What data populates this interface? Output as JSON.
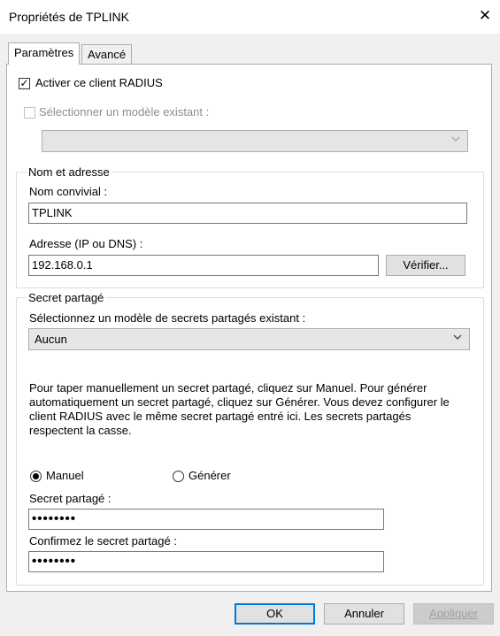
{
  "window": {
    "title": "Propriétés de TPLINK",
    "close_glyph": "✕"
  },
  "tabs": [
    {
      "label": "Paramètres",
      "active": true
    },
    {
      "label": "Avancé",
      "active": false
    }
  ],
  "radius_client": {
    "label": "Activer ce client RADIUS",
    "checked": true
  },
  "template": {
    "label": "Sélectionner un modèle existant :",
    "checked": false,
    "enabled": false,
    "value": ""
  },
  "name_address": {
    "legend": "Nom et adresse",
    "friendly_name_label": "Nom convivial :",
    "friendly_name_value": "TPLINK",
    "address_label": "Adresse (IP ou DNS) :",
    "address_value": "192.168.0.1",
    "verify_label": "Vérifier..."
  },
  "shared_secret": {
    "legend": "Secret partagé",
    "template_label": "Sélectionnez un modèle de secrets partagés existant :",
    "template_value": "Aucun",
    "description": "Pour taper manuellement un secret partagé, cliquez sur Manuel. Pour générer automatiquement un secret partagé, cliquez sur Générer. Vous devez configurer le client RADIUS avec le même secret partagé entré ici. Les secrets partagés respectent la casse.",
    "manual_label": "Manuel",
    "generate_label": "Générer",
    "selected_mode": "Manuel",
    "secret_label": "Secret partagé :",
    "secret_value": "••••••••",
    "confirm_label": "Confirmez le secret partagé :",
    "confirm_value": "••••••••"
  },
  "buttons": {
    "ok": "OK",
    "cancel": "Annuler",
    "apply": "Appliquer"
  },
  "colors": {
    "accent": "#0078d7",
    "window_bg": "#f0f0f0",
    "panel_bg": "#ffffff"
  },
  "icons": {
    "close": "close-icon",
    "dropdown": "chevron-down-icon",
    "check": "checkmark-icon"
  }
}
